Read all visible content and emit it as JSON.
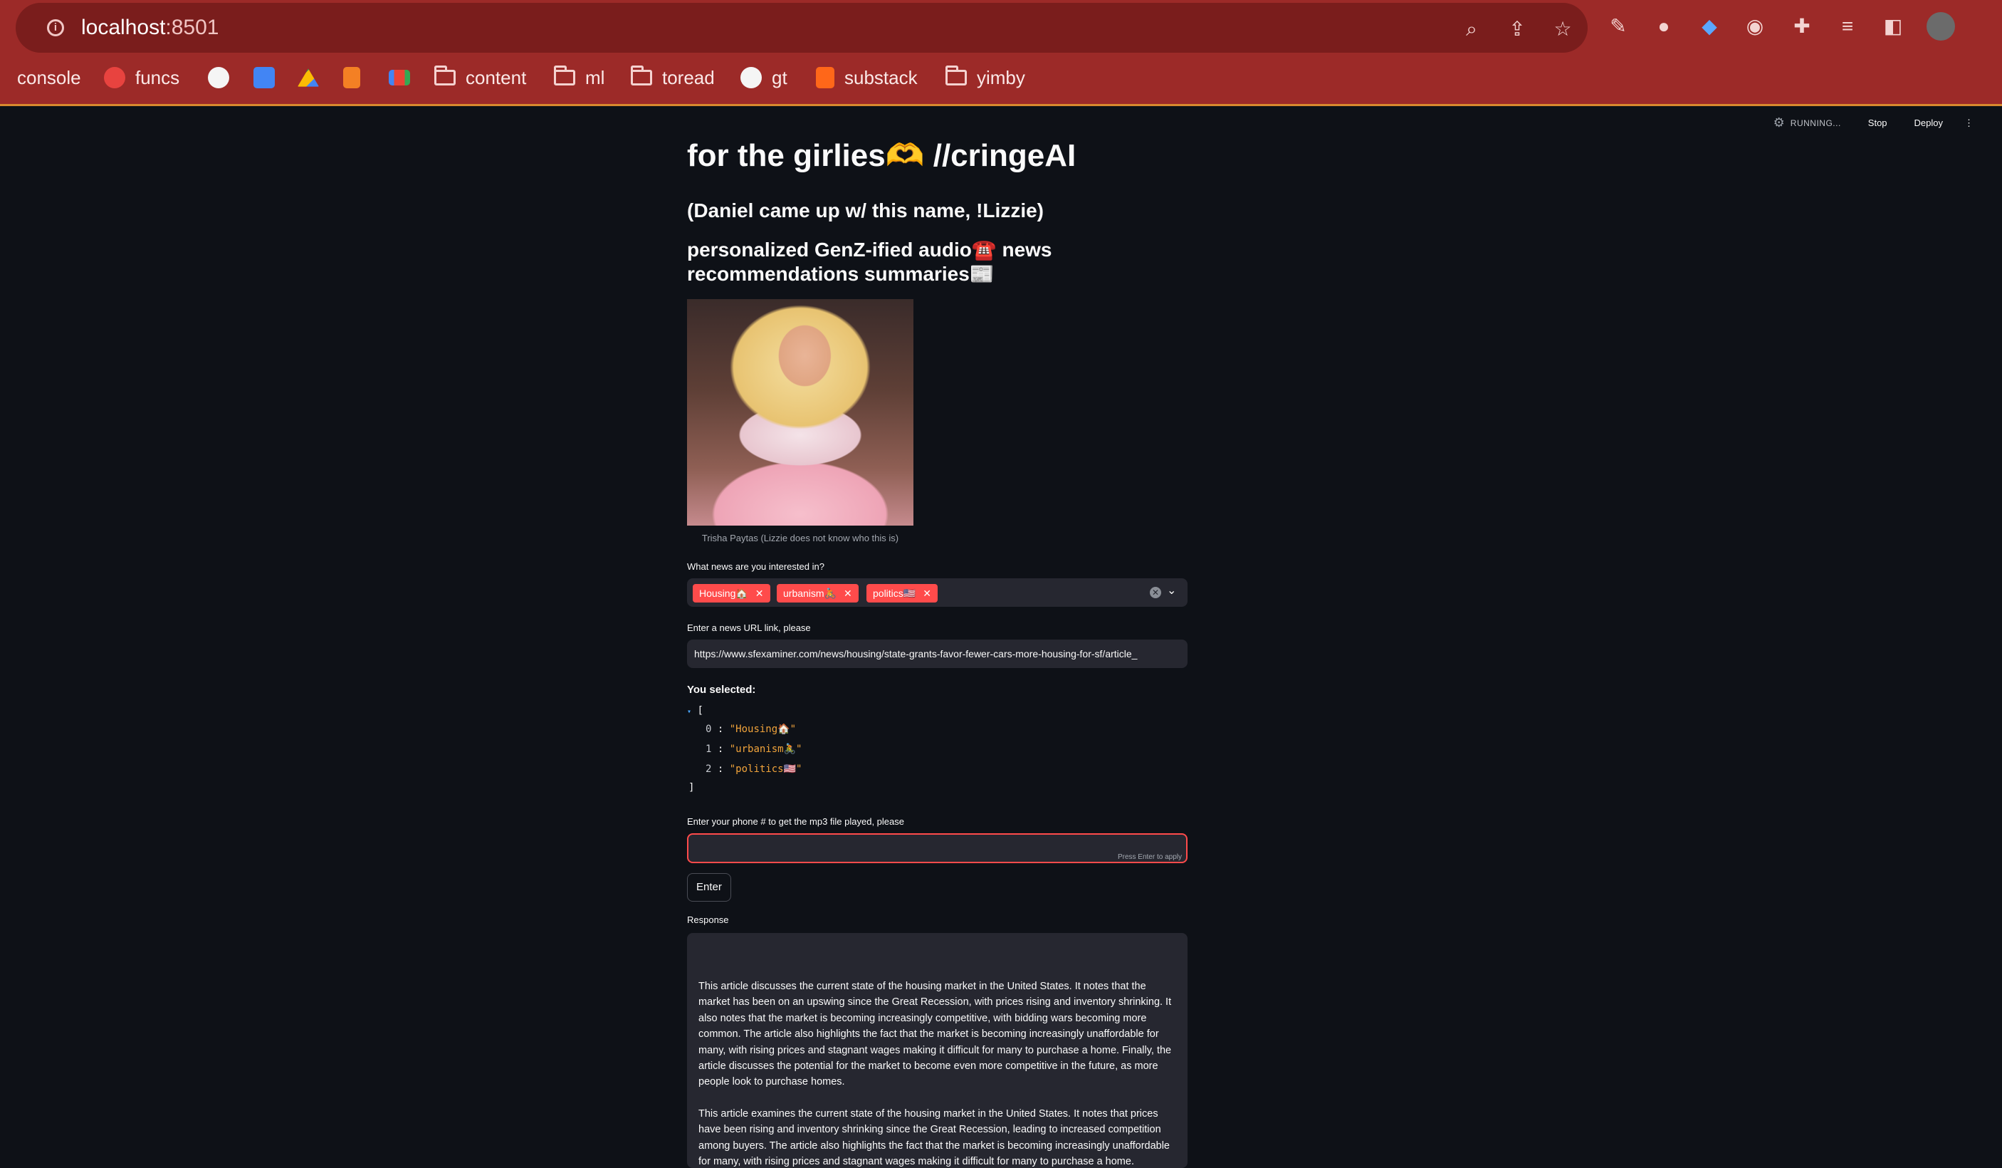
{
  "browser": {
    "url_host": "localhost",
    "url_port": ":8501",
    "toolbar_icons": [
      "zoom-icon",
      "share-icon",
      "star-icon",
      "eyedropper-icon",
      "extension-blob-icon",
      "gem-icon",
      "password-icon",
      "puzzle-icon",
      "media-queue-icon",
      "sidebar-icon",
      "profile-avatar"
    ],
    "bookmarks": [
      {
        "label": "console",
        "icon": "console-icon"
      },
      {
        "label": "funcs",
        "icon": "funcs-icon"
      },
      {
        "label": "",
        "icon": "github-icon"
      },
      {
        "label": "",
        "icon": "calendar-icon"
      },
      {
        "label": "",
        "icon": "drive-icon"
      },
      {
        "label": "",
        "icon": "stackoverflow-icon"
      },
      {
        "label": "",
        "icon": "gmail-icon"
      },
      {
        "label": "content",
        "icon": "folder-icon"
      },
      {
        "label": "ml",
        "icon": "folder-icon"
      },
      {
        "label": "toread",
        "icon": "folder-icon"
      },
      {
        "label": "gt",
        "icon": "globe-icon"
      },
      {
        "label": "substack",
        "icon": "substack-icon"
      },
      {
        "label": "yimby",
        "icon": "folder-icon"
      }
    ]
  },
  "streamlit_header": {
    "running": "RUNNING...",
    "stop": "Stop",
    "deploy": "Deploy"
  },
  "page": {
    "title": "for the girlies🫶 //cringeAI",
    "subtitle": "(Daniel came up w/ this name, !Lizzie)",
    "tagline": "personalized GenZ-ified audio☎️ news recommendations summaries📰",
    "image_caption": "Trisha Paytas (Lizzie does not know who this is)"
  },
  "form": {
    "interest_label": "What news are you interested in?",
    "selected_tags": [
      "Housing🏠",
      "urbanism🚴",
      "politics🇺🇸"
    ],
    "url_label": "Enter a news URL link, please",
    "url_value": "https://www.sfexaminer.com/news/housing/state-grants-favor-fewer-cars-more-housing-for-sf/article_",
    "selected_heading": "You selected:",
    "json_open": "[",
    "json_close": "]",
    "json_items": [
      {
        "index": "0",
        "value": "\"Housing🏠\""
      },
      {
        "index": "1",
        "value": "\"urbanism🚴\""
      },
      {
        "index": "2",
        "value": "\"politics🇺🇸\""
      }
    ],
    "phone_label": "Enter your phone # to get the mp3 file played, please",
    "phone_value": "",
    "phone_hint": "Press Enter to apply",
    "enter_button": "Enter",
    "response_label": "Response",
    "response_paragraphs": [
      "This article discusses the current state of the housing market in the United States. It notes that the market has been on an upswing since the Great Recession, with prices rising and inventory shrinking. It also notes that the market is becoming increasingly competitive, with bidding wars becoming more common. The article also highlights the fact that the market is becoming increasingly unaffordable for many, with rising prices and stagnant wages making it difficult for many to purchase a home. Finally, the article discusses the potential for the market to become even more competitive in the future, as more people look to purchase homes.",
      "This article examines the current state of the housing market in the United States. It notes that prices have been rising and inventory shrinking since the Great Recession, leading to increased competition among buyers. The article also highlights the fact that the market is becoming increasingly unaffordable for many, with rising prices and stagnant wages making it difficult for many to purchase a home."
    ]
  },
  "colors": {
    "chrome_red": "#9c2a28",
    "app_bg": "#0e1117",
    "widget_bg": "#262730",
    "accent": "#ff4b4b"
  }
}
